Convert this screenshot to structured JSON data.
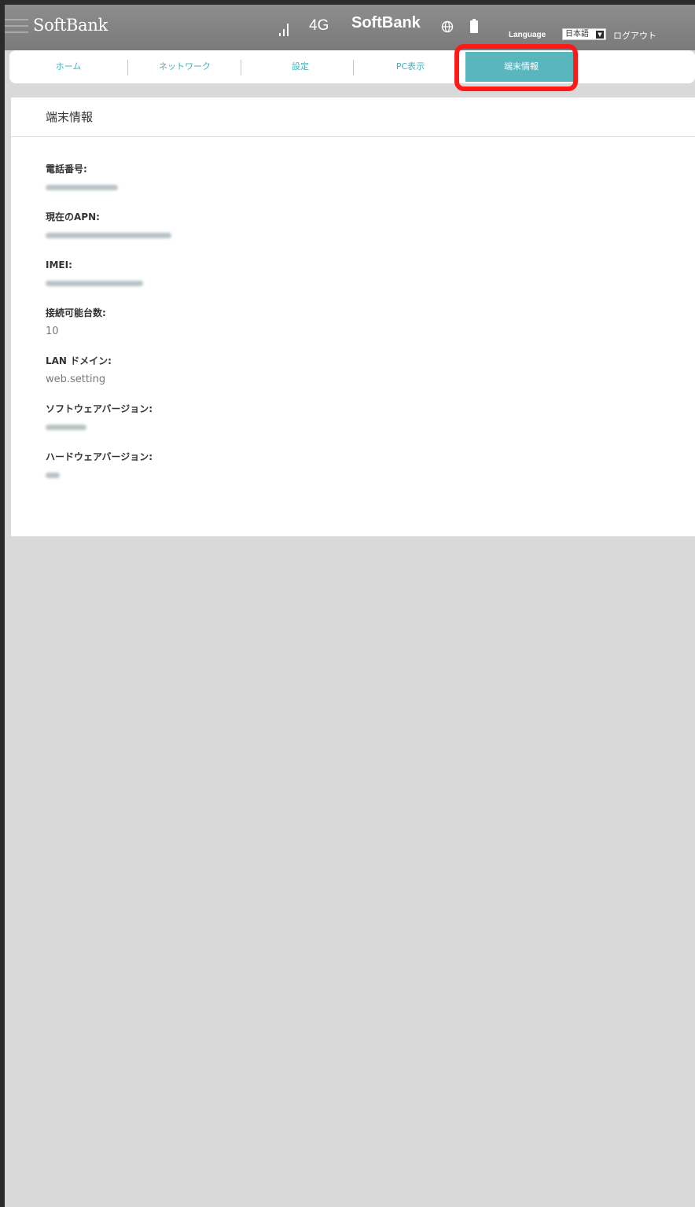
{
  "header": {
    "logo": "SoftBank",
    "network_type": "4G",
    "carrier": "SoftBank",
    "language_label": "Language",
    "language_value": "日本語",
    "logout_label": "ログアウト"
  },
  "nav": {
    "tabs": [
      {
        "label": "ホーム"
      },
      {
        "label": "ネットワーク"
      },
      {
        "label": "設定"
      },
      {
        "label": "PC表示"
      },
      {
        "label": "端末情報"
      }
    ],
    "active_index": 4
  },
  "page": {
    "title": "端末情報",
    "fields": [
      {
        "label": "電話番号:",
        "value": ""
      },
      {
        "label": "現在のAPN:",
        "value": ""
      },
      {
        "label": "IMEI:",
        "value": ""
      },
      {
        "label": "接続可能台数:",
        "value": "10"
      },
      {
        "label": "LAN ドメイン:",
        "value": "web.setting"
      },
      {
        "label": "ソフトウェアバージョン:",
        "value": ""
      },
      {
        "label": "ハードウェアバージョン:",
        "value": ""
      }
    ]
  },
  "colors": {
    "accent": "#5ab6bd",
    "highlight": "#ff1a1a",
    "header_bg": "#808080",
    "page_bg": "#d9d9d9"
  }
}
